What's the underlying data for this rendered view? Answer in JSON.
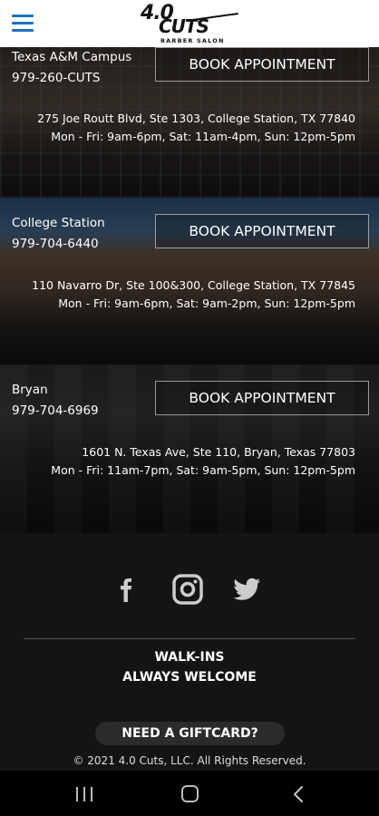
{
  "header": {
    "logo_top": "4.0",
    "logo_bottom": "CUTS",
    "logo_sub": "BARBER SALON"
  },
  "locations": [
    {
      "name": "Texas A&M Campus",
      "phone": "979-260-CUTS",
      "book_label": "BOOK APPOINTMENT",
      "address": "275 Joe Routt Blvd, Ste 1303, College Station, TX 77840",
      "hours": "Mon - Fri: 9am-6pm, Sat: 11am-4pm, Sun: 12pm-5pm"
    },
    {
      "name": "College Station",
      "phone": "979-704-6440",
      "book_label": "BOOK APPOINTMENT",
      "address": "110 Navarro Dr, Ste 100&300, College Station, TX 77845",
      "hours": "Mon - Fri: 9am-6pm, Sat: 9am-2pm, Sun: 12pm-5pm"
    },
    {
      "name": "Bryan",
      "phone": "979-704-6969",
      "book_label": "BOOK APPOINTMENT",
      "address": "1601 N. Texas Ave, Ste 110, Bryan, Texas 77803",
      "hours": "Mon - Fri: 11am-7pm, Sat: 9am-5pm, Sun: 12pm-5pm"
    }
  ],
  "footer": {
    "social_icons": [
      "facebook-icon",
      "instagram-icon",
      "twitter-icon"
    ],
    "walkins_line1": "WALK-INS",
    "walkins_line2": "ALWAYS WELCOME",
    "giftcard_label": "NEED A GIFTCARD?",
    "copyright": "© 2021 4.0 Cuts, LLC. All Rights Reserved."
  },
  "colors": {
    "menu_accent": "#1e73be",
    "footer_bg": "#141414"
  }
}
